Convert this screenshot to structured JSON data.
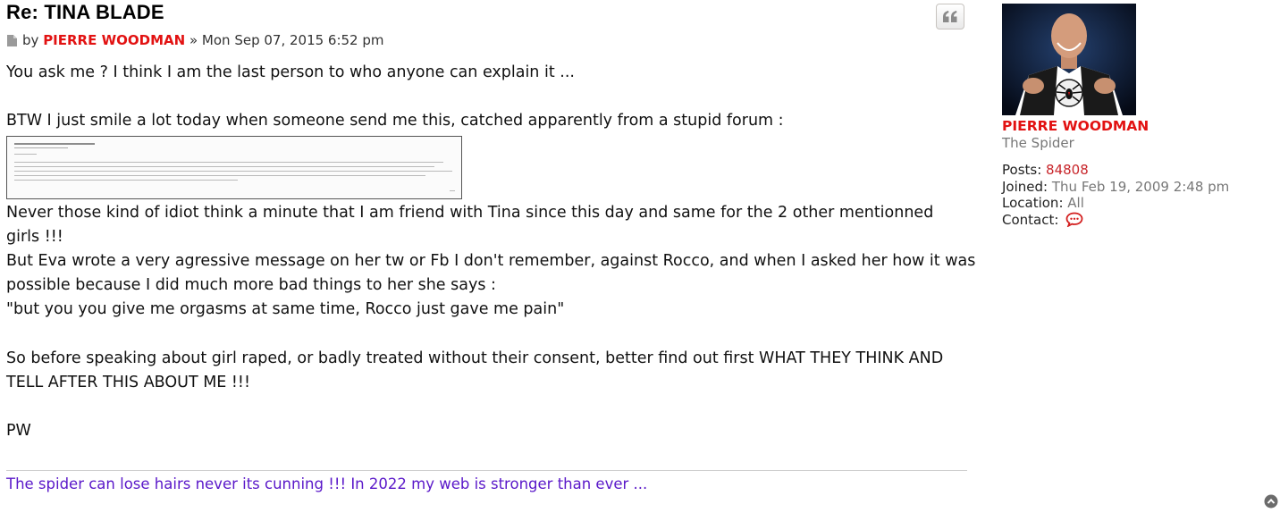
{
  "post": {
    "title": "Re: TINA BLADE",
    "by_label": "by",
    "author": "PIERRE WOODMAN",
    "separator": "»",
    "date": "Mon Sep 07, 2015 6:52 pm",
    "body": {
      "line1": "You ask me ? I think I am the last person to who anyone can explain it ...",
      "line2": "BTW I just smile a lot today when someone send me this, catched apparently from a stupid forum :",
      "line3": "Never those kind of idiot think a minute that I am friend with Tina since this day and same for the 2 other mentionned",
      "line4": "girls !!!",
      "line5": "But Eva wrote a very agressive message on her tw or Fb I don't remember, against Rocco, and when I asked her how it was",
      "line6": "possible because I did much more bad things to her she says :",
      "line7": "\"but you you give me orgasms at same time, Rocco just gave me pain\"",
      "line8": "So before speaking about girl raped, or badly treated without their consent, better find out first WHAT THEY THINK AND",
      "line9": "TELL AFTER THIS ABOUT ME !!!",
      "line10": "PW"
    },
    "signature": "The spider can lose hairs never its cunning !!! In 2022 my web is stronger than ever ..."
  },
  "profile": {
    "name": "PIERRE WOODMAN",
    "rank": "The Spider",
    "posts_label": "Posts:",
    "posts_value": "84808",
    "joined_label": "Joined:",
    "joined_value": "Thu Feb 19, 2009 2:48 pm",
    "location_label": "Location:",
    "location_value": "All",
    "contact_label": "Contact:"
  },
  "icons": {
    "quote": "quote-icon",
    "post": "post-document-icon",
    "contact": "speech-bubble-icon",
    "top": "back-to-top-icon"
  },
  "colors": {
    "author_red": "#e21212",
    "signature_purple": "#5a18c9",
    "muted": "#777777"
  }
}
